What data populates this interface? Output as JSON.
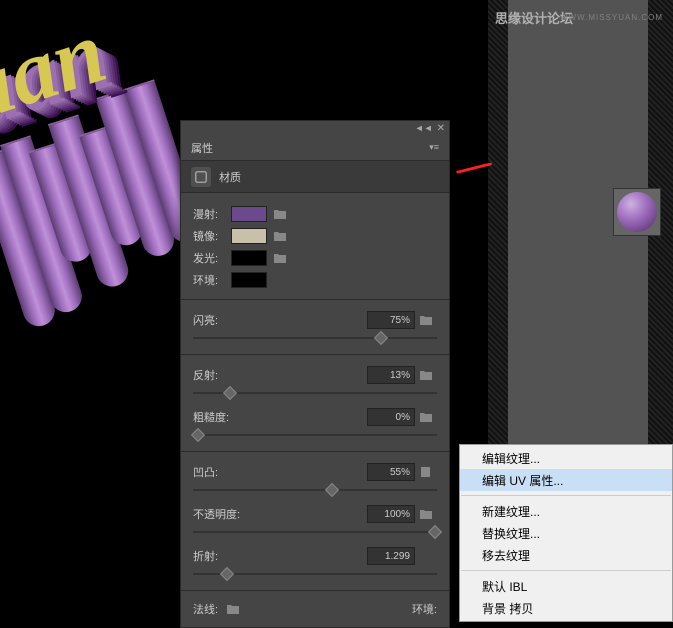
{
  "watermark": {
    "cn": "思缘设计论坛",
    "en": "WWW.MISSYUAN.COM"
  },
  "text3d": "uan",
  "panel": {
    "title": "属性",
    "subtitle": "材质",
    "colors": {
      "diffuse": {
        "label": "漫射:",
        "value": "#6a4a8a"
      },
      "specular": {
        "label": "镜像:",
        "value": "#c8c0a8"
      },
      "glow": {
        "label": "发光:",
        "value": "#000000"
      },
      "ambient": {
        "label": "环境:",
        "value": "#000000"
      }
    },
    "sliders": {
      "shine": {
        "label": "闪亮:",
        "value": "75%",
        "pos": 75
      },
      "reflect": {
        "label": "反射:",
        "value": "13%",
        "pos": 13
      },
      "rough": {
        "label": "粗糙度:",
        "value": "0%",
        "pos": 0
      },
      "bump": {
        "label": "凹凸:",
        "value": "55%",
        "pos": 55
      },
      "opacity": {
        "label": "不透明度:",
        "value": "100%",
        "pos": 100
      },
      "refract": {
        "label": "折射:",
        "value": "1.299",
        "pos": 12
      }
    },
    "bottom": {
      "normal": "法线:",
      "env": "环境:"
    }
  },
  "menu": {
    "editTexture": "编辑纹理...",
    "editUV": "编辑 UV 属性...",
    "newTexture": "新建纹理...",
    "replaceTexture": "替换纹理...",
    "removeTexture": "移去纹理",
    "defaultIBL": "默认 IBL",
    "bgCopy": "背景 拷贝"
  }
}
